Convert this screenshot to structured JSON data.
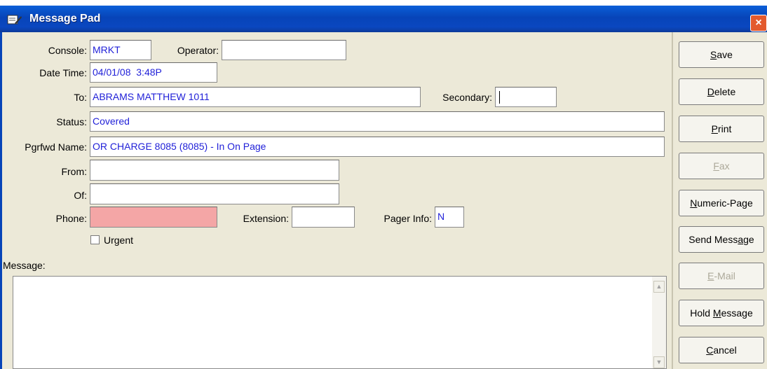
{
  "window": {
    "title": "Message Pad",
    "title_icon": "notepad-pen-icon",
    "close_label": "×"
  },
  "form": {
    "console_label": "Console:",
    "console_value": "MRKT",
    "operator_label": "Operator:",
    "operator_value": "",
    "datetime_label": "Date Time:",
    "datetime_value": "04/01/08  3:48P",
    "to_label": "To:",
    "to_value": "ABRAMS MATTHEW 1011",
    "secondary_label": "Secondary:",
    "secondary_value": "",
    "status_label": "Status:",
    "status_value": "Covered",
    "pgrfwd_label": "Pgrfwd Name:",
    "pgrfwd_value": "OR CHARGE 8085 (8085) - In On Page",
    "from_label": "From:",
    "from_value": "",
    "of_label": "Of:",
    "of_value": "",
    "phone_label": "Phone:",
    "phone_value": "",
    "phone_bg": "#f4a6a6",
    "extension_label": "Extension:",
    "extension_value": "",
    "pager_label": "Pager Info:",
    "pager_value": "N",
    "urgent_label": "Urgent",
    "urgent_checked": false,
    "message_label": "Message:",
    "message_value": ""
  },
  "buttons": [
    {
      "pre": "",
      "u": "S",
      "post": "ave",
      "enabled": true
    },
    {
      "pre": "",
      "u": "D",
      "post": "elete",
      "enabled": true
    },
    {
      "pre": "",
      "u": "P",
      "post": "rint",
      "enabled": true
    },
    {
      "pre": "",
      "u": "F",
      "post": "ax",
      "enabled": false
    },
    {
      "pre": "",
      "u": "N",
      "post": "umeric-Page",
      "enabled": true
    },
    {
      "pre": "Send Mess",
      "u": "a",
      "post": "ge",
      "enabled": true
    },
    {
      "pre": "",
      "u": "E",
      "post": "-Mail",
      "enabled": false
    },
    {
      "pre": "Hold ",
      "u": "M",
      "post": "essage",
      "enabled": true
    },
    {
      "pre": "",
      "u": "C",
      "post": "ancel",
      "enabled": true
    }
  ],
  "colors": {
    "titlebar": "#0744b8",
    "field_text": "#1f1fd8",
    "panel": "#ece9d8"
  }
}
